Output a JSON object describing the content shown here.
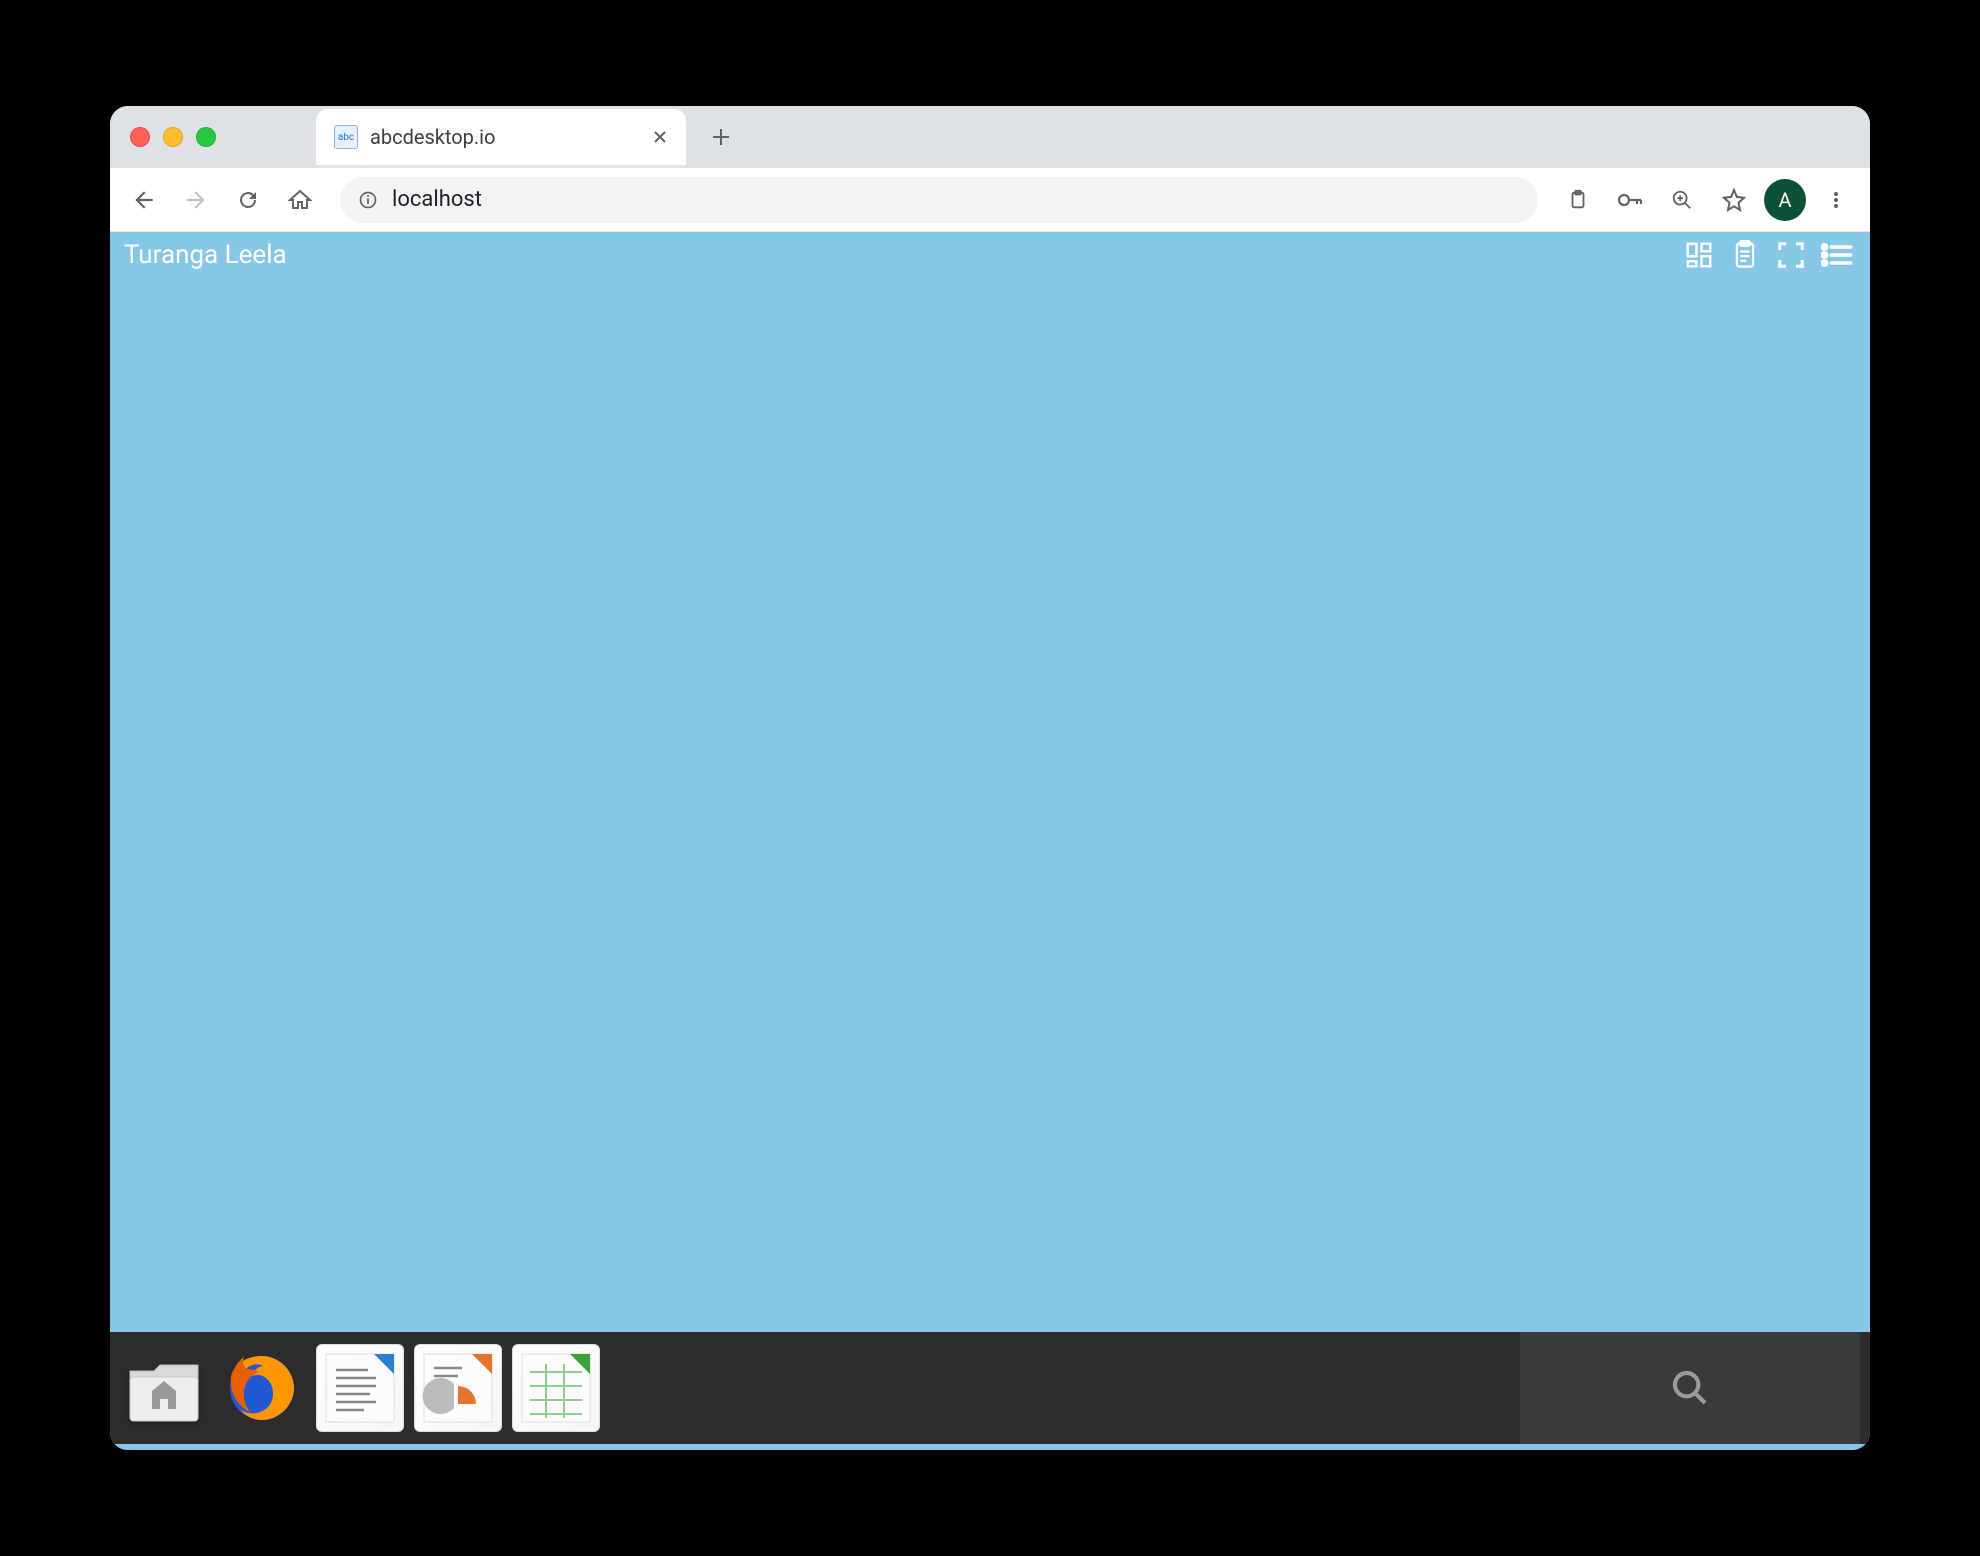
{
  "browser": {
    "tab_title": "abcdesktop.io",
    "favicon_text": "abc",
    "url": "localhost",
    "avatar_letter": "A"
  },
  "desktop": {
    "username": "Turanga Leela",
    "top_icons": [
      "apps-grid",
      "clipboard",
      "fullscreen",
      "menu-list"
    ],
    "taskbar_apps": [
      "files",
      "firefox",
      "writer",
      "impress",
      "calc"
    ]
  },
  "colors": {
    "desktop_bg": "#86c7e8",
    "taskbar_bg": "#2c2c2c",
    "avatar_bg": "#0b5136"
  }
}
